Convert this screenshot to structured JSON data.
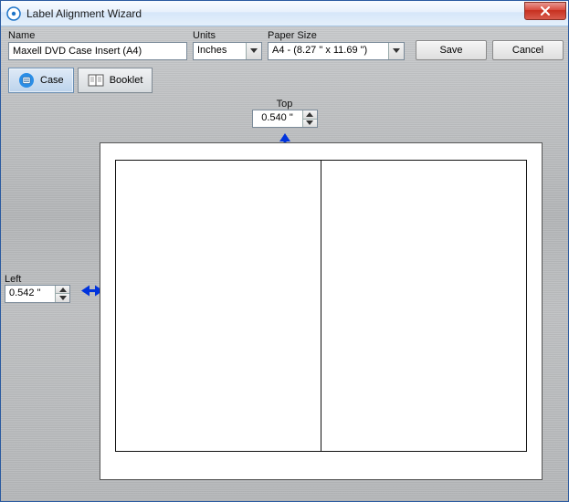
{
  "window": {
    "title": "Label Alignment Wizard"
  },
  "form": {
    "name": {
      "label": "Name",
      "value": "Maxell DVD Case Insert (A4)"
    },
    "units": {
      "label": "Units",
      "value": "Inches"
    },
    "paper_size": {
      "label": "Paper Size",
      "value": "A4 - (8.27 \" x 11.69 \")"
    },
    "save_btn": "Save",
    "cancel_btn": "Cancel"
  },
  "tabs": {
    "case": "Case",
    "booklet": "Booklet"
  },
  "measures": {
    "top_label": "Top",
    "top_value": "0.540 \"",
    "left_label": "Left",
    "left_value": "0.542 \""
  }
}
